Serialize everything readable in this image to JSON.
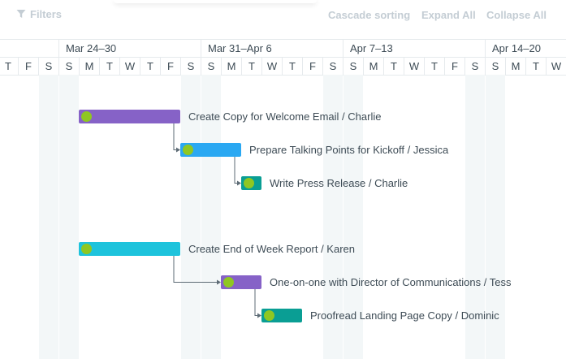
{
  "toolbar": {
    "filters_label": "Filters",
    "cascade_label": "Cascade sorting",
    "expand_label": "Expand All",
    "collapse_label": "Collapse All"
  },
  "timeline": {
    "weeks": [
      {
        "label": "Mar 24–30"
      },
      {
        "label": "Mar 31–Apr 6"
      },
      {
        "label": "Apr 7–13"
      },
      {
        "label": "Apr 14–20"
      }
    ],
    "days": [
      "T",
      "F",
      "S",
      "S",
      "M",
      "T",
      "W",
      "T",
      "F",
      "S",
      "S",
      "M",
      "T",
      "W",
      "T",
      "F",
      "S",
      "S",
      "M",
      "T",
      "W",
      "T",
      "F",
      "S",
      "S",
      "M",
      "T",
      "W"
    ]
  },
  "tasks": [
    {
      "label": "Create Copy for Welcome Email / Charlie",
      "color": "#8662c7"
    },
    {
      "label": "Prepare Talking Points for Kickoff / Jessica",
      "color": "#2aa8f2"
    },
    {
      "label": "Write Press Release / Charlie",
      "color": "#0a9e94"
    },
    {
      "label": "Create End of Week Report / Karen",
      "color": "#1ec3dc"
    },
    {
      "label": "One-on-one with Director of Communications / Tess",
      "color": "#8662c7"
    },
    {
      "label": "Proofread Landing Page Copy / Dominic",
      "color": "#0a9e94"
    }
  ],
  "colors": {
    "handle": "#8fc722",
    "grid_line": "#e6eaed",
    "weekend_shade": "#f3f7f8",
    "toolbar_text": "#c4cdd4",
    "label_text": "#3d4b55"
  }
}
